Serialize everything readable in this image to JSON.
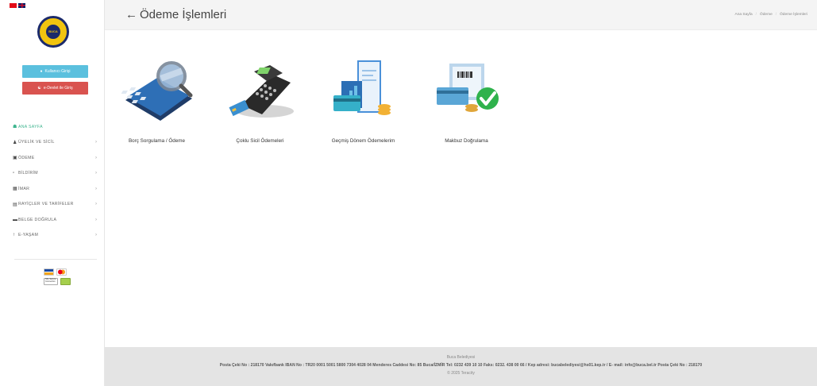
{
  "sidebar": {
    "flags": [
      "TR",
      "EN"
    ],
    "logo_text": "BUCA",
    "logo_ring": "BELEDİYESİ",
    "login_label": "Kullanıcı Girişi",
    "edevlet_label": "e-Devlet ile Giriş",
    "items": [
      {
        "icon": "home-icon",
        "label": "ANA SAYFA",
        "chev": ""
      },
      {
        "icon": "user-icon",
        "label": "ÜYELİK VE SİCİL",
        "chev": "›"
      },
      {
        "icon": "credit-card-icon",
        "label": "ÖDEME",
        "chev": "›"
      },
      {
        "icon": "document-icon",
        "label": "BİLDİRİM",
        "chev": "›"
      },
      {
        "icon": "map-icon",
        "label": "İMAR",
        "chev": "›"
      },
      {
        "icon": "list-icon",
        "label": "RAYİÇLER VE TARİFELER",
        "chev": "›"
      },
      {
        "icon": "folder-icon",
        "label": "BELGE DOĞRULA",
        "chev": "›"
      },
      {
        "icon": "tree-icon",
        "label": "E-YAŞAM",
        "chev": "›"
      }
    ],
    "ssl_text": "SSL Secure Connection"
  },
  "header": {
    "back_glyph": "←",
    "title": "Ödeme İşlemleri",
    "breadcrumb": [
      "Ana Sayfa",
      "Ödeme",
      "Ödeme İşlemleri"
    ],
    "separator": "/"
  },
  "tiles": [
    {
      "label": "Borç Sorgulama / Ödeme",
      "icon": "calculator-magnifier-icon"
    },
    {
      "label": "Çoklu Sicil Ödemeleri",
      "icon": "pos-terminal-icon"
    },
    {
      "label": "Geçmiş Dönem Ödemelerim",
      "icon": "receipt-chart-icon"
    },
    {
      "label": "Makbuz Doğrulama",
      "icon": "receipt-check-icon"
    }
  ],
  "footer": {
    "org": "Buca Belediyesi",
    "info": "Posta Çeki No : 218170 Vakıfbank IBAN No : TR20 0001 5001 5800 7304 4028 04 Menderes Caddesi No: 85 Buca/İZMİR Tel: 0232 439 10 10 Faks: 0232. 438 00 66 / Kep adresi: bucabelediyesi@hs01.kep.tr / E- mail: info@buca.bel.tr Posta Çeki No : 218170",
    "copyright": "© 2025 Teracity"
  },
  "colors": {
    "accent_green": "#3fb58f",
    "login_blue": "#5bc0de",
    "edevlet_red": "#d9534f"
  }
}
